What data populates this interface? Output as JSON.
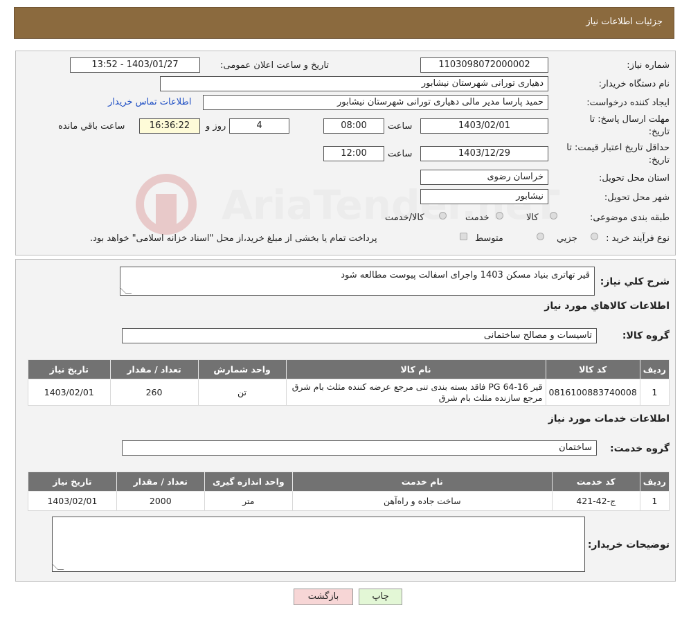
{
  "header": {
    "title": "جزئیات اطلاعات نیاز"
  },
  "details": {
    "need_number_label": "شماره نیاز:",
    "need_number": "1103098072000002",
    "announce_label": "تاریخ و ساعت اعلان عمومی:",
    "announce_value": "1403/01/27 - 13:52",
    "buyer_org_label": "نام دستگاه خریدار:",
    "buyer_org": "دهیاری تورانی  شهرستان نیشابور",
    "requester_label": "ایجاد کننده درخواست:",
    "requester": "حمید پارسا مدیر مالی دهیاری تورانی  شهرستان نیشابور",
    "contact_link": "اطلاعات تماس خریدار",
    "deadline_label_1": "مهلت ارسال پاسخ: تا",
    "deadline_label_2": "تاریخ:",
    "deadline_date": "1403/02/01",
    "time_label": "ساعت",
    "deadline_time": "08:00",
    "days": "4",
    "days_label": "روز و",
    "remaining": "16:36:22",
    "remaining_label": "ساعت باقي مانده",
    "validity_label_1": "حداقل تاریخ اعتبار قیمت: تا",
    "validity_label_2": "تاریخ:",
    "validity_date": "1403/12/29",
    "validity_time": "12:00",
    "province_label": "استان محل تحویل:",
    "province": "خراسان رضوی",
    "city_label": "شهر محل تحویل:",
    "city": "نیشابور",
    "category_label": "طبقه بندی موضوعی:",
    "category_options": [
      "کالا",
      "خدمت",
      "کالا/خدمت"
    ],
    "process_label": "نوع فرآیند خرید :",
    "process_options": [
      "جزیي",
      "متوسط"
    ],
    "process_note": "پرداخت تمام یا بخشی از مبلغ خرید،از محل \"اسناد خزانه اسلامی\" خواهد بود."
  },
  "watermark": "AriaTender.neT",
  "summary": {
    "label": "شرح کلي نیاز:",
    "text": "قیر تهاتری بنیاد مسکن 1403 واجرای اسفالت پیوست مطالعه شود",
    "goods_title": "اطلاعات کالاهاي مورد نیاز",
    "goods_group_label": "گروه کالا:",
    "goods_group": "تاسیسات و مصالح ساختمانی"
  },
  "goods_table": {
    "headers": [
      "ردیف",
      "کد کالا",
      "نام کالا",
      "واحد شمارش",
      "تعداد / مقدار",
      "تاریخ نیاز"
    ],
    "rows": [
      [
        "1",
        "0816100883740008",
        "قیر PG 64-16 فاقد بسته بندی تنی مرجع عرضه کننده مثلث بام شرق مرجع سازنده مثلث بام شرق",
        "تن",
        "260",
        "1403/02/01"
      ]
    ]
  },
  "services": {
    "title": "اطلاعات خدمات مورد نیاز",
    "group_label": "گروه خدمت:",
    "group": "ساختمان"
  },
  "services_table": {
    "headers": [
      "ردیف",
      "کد خدمت",
      "نام خدمت",
      "واحد اندازه گیری",
      "تعداد / مقدار",
      "تاریخ نیاز"
    ],
    "rows": [
      [
        "1",
        "ج-42-421",
        "ساخت جاده و راه‌آهن",
        "متر",
        "2000",
        "1403/02/01"
      ]
    ]
  },
  "buyer_notes": {
    "label": "توضیحات خریدار:",
    "text": ""
  },
  "buttons": {
    "print": "چاپ",
    "back": "بازگشت"
  }
}
